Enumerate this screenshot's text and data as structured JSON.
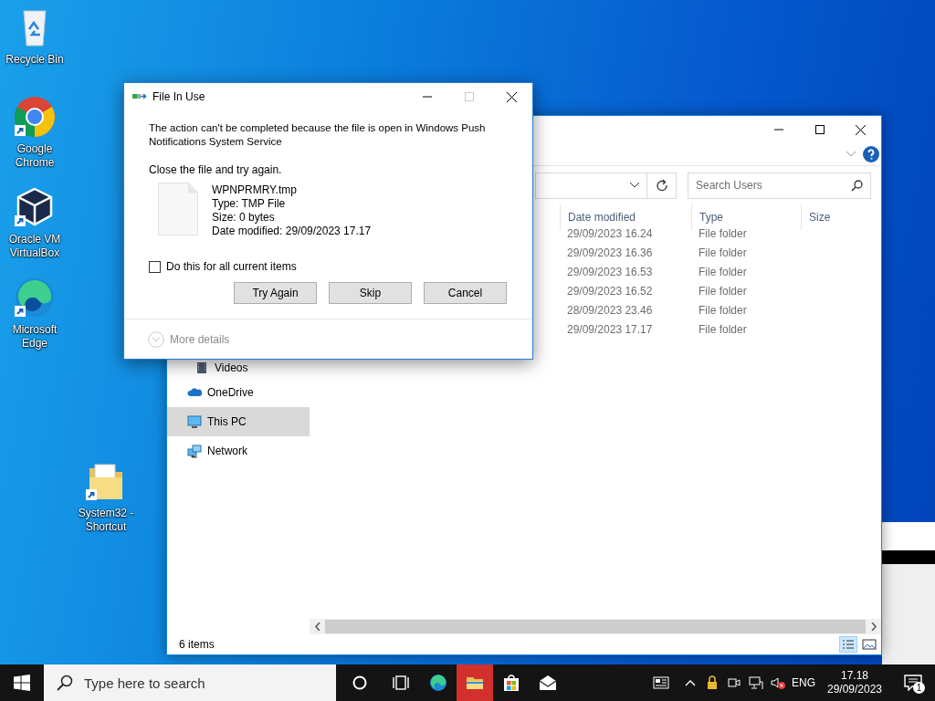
{
  "desktop_icons": [
    {
      "label": "Recycle Bin",
      "kind": "recycle"
    },
    {
      "label": "Google Chrome",
      "kind": "chrome"
    },
    {
      "label": "Oracle VM VirtualBox",
      "kind": "vbox"
    },
    {
      "label": "Microsoft Edge",
      "kind": "edge"
    },
    {
      "label": "System32 - Shortcut",
      "kind": "folder"
    }
  ],
  "explorer": {
    "search": {
      "placeholder": "Search Users"
    },
    "columns": [
      "Date modified",
      "Type",
      "Size"
    ],
    "rows": [
      {
        "date": "29/09/2023 16.24",
        "type": "File folder"
      },
      {
        "date": "29/09/2023 16.36",
        "type": "File folder"
      },
      {
        "date": "29/09/2023 16.53",
        "type": "File folder"
      },
      {
        "date": "29/09/2023 16.52",
        "type": "File folder"
      },
      {
        "date": "28/09/2023 23.46",
        "type": "File folder"
      },
      {
        "date": "29/09/2023 17.17",
        "type": "File folder"
      }
    ],
    "nav": [
      {
        "label": "Videos",
        "kind": "videos",
        "selected": false
      },
      {
        "label": "OneDrive",
        "kind": "onedrive",
        "selected": false
      },
      {
        "label": "This PC",
        "kind": "pc",
        "selected": true
      },
      {
        "label": "Network",
        "kind": "network",
        "selected": false
      }
    ],
    "status": "6 items"
  },
  "dialog": {
    "title": "File In Use",
    "message": "The action can't be completed because the file is open in Windows Push Notifications System Service",
    "instruction": "Close the file and try again.",
    "file": {
      "name": "WPNPRMRY.tmp",
      "type": "Type: TMP File",
      "size": "Size: 0 bytes",
      "date": "Date modified: 29/09/2023 17.17"
    },
    "apply_all": {
      "label": "Do this for all current items",
      "checked": false
    },
    "buttons": [
      "Try Again",
      "Skip",
      "Cancel"
    ],
    "more_details": "More details"
  },
  "taskbar": {
    "search": {
      "placeholder": "Type here to search"
    },
    "apps": [
      {
        "kind": "taskview",
        "selected": false
      },
      {
        "kind": "edge",
        "selected": false
      },
      {
        "kind": "explorer",
        "selected": true
      },
      {
        "kind": "store",
        "selected": false
      },
      {
        "kind": "mail",
        "selected": false
      }
    ],
    "language": "ENG",
    "time": "17.18",
    "date": "29/09/2023",
    "notifications": "1"
  }
}
